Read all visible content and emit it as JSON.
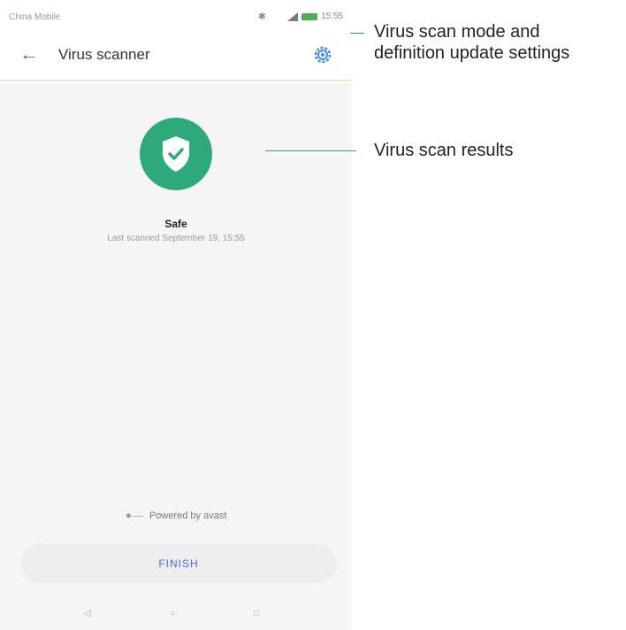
{
  "status_bar": {
    "carrier": "China Mobile",
    "time": "15:55"
  },
  "app_bar": {
    "title": "Virus scanner"
  },
  "result": {
    "status": "Safe",
    "last_scanned": "Last scanned September 19, 15:55"
  },
  "footer": {
    "powered_by": "Powered by avast",
    "finish_label": "FINISH"
  },
  "callouts": {
    "settings_line1": "Virus scan mode and",
    "settings_line2": "definition update settings",
    "results": "Virus scan results"
  },
  "colors": {
    "safe_green": "#2eaa7a",
    "accent_blue": "#4a6fd0",
    "callout_line": "#2f9a8a"
  }
}
